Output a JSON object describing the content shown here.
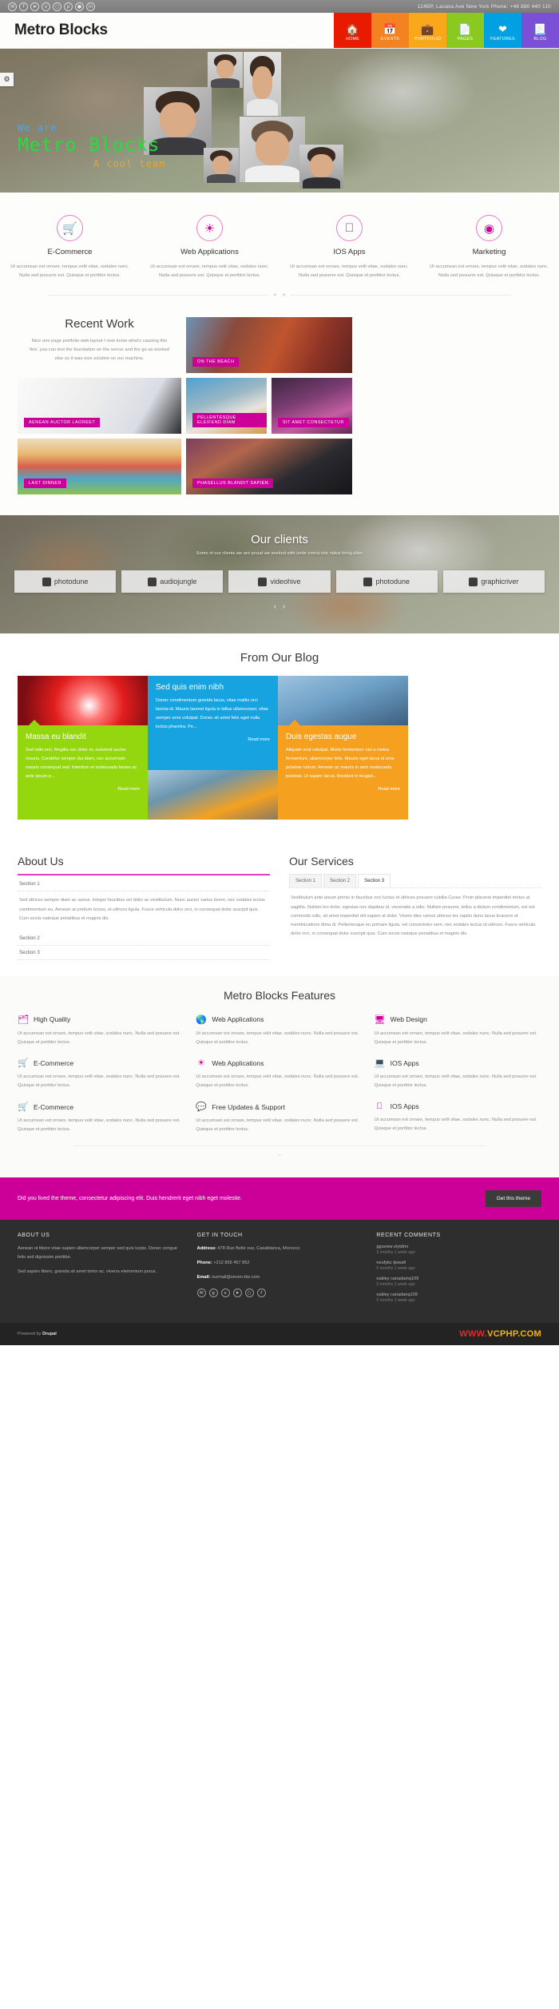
{
  "topbar": {
    "social": [
      "envelope",
      "facebook",
      "twitter",
      "vimeo",
      "github",
      "pinterest",
      "flickr",
      "linkedin"
    ],
    "contact": "124BP, Lacasa Ave New York Phone: +48 880 440 110"
  },
  "header": {
    "logo": "Metro Blocks",
    "nav": [
      {
        "label": "HOME",
        "icon": "⌂",
        "color": "#e81b00"
      },
      {
        "label": "EVENTS",
        "icon": "Ὄ5",
        "color": "#f58220"
      },
      {
        "label": "PORTFOLIO",
        "icon": "ὋC",
        "color": "#f9a71b"
      },
      {
        "label": "PAGES",
        "icon": "Ὄ4",
        "color": "#8bc920"
      },
      {
        "label": "FEATURES",
        "icon": "♥",
        "color": "#00a0e3"
      },
      {
        "label": "BLOG",
        "icon": "Ὄ3",
        "color": "#7b4fd6"
      }
    ]
  },
  "hero": {
    "gear_icon": "gear-icon",
    "we_are": "We are",
    "title": "Metro Blocks",
    "subtitle": "A cool team"
  },
  "services": {
    "items": [
      {
        "title": "E-Commerce",
        "icon": "Ὥ2",
        "desc": "Ut accumsan est ornare, tempus velit vitae, sodales nunc. Nulla sed posuere est. Quisque et porttitor lectus."
      },
      {
        "title": "Web Applications",
        "icon": "◔",
        "desc": "Ut accumsan est ornare, tempus velit vitae, sodales nunc. Nulla sed posuere est. Quisque et porttitor lectus."
      },
      {
        "title": "IOS Apps",
        "icon": "ἴE",
        "desc": "Ut accumsan est ornare, tempus velit vitae, sodales nunc. Nulla sed posuere est. Quisque et porttitor lectus."
      },
      {
        "title": "Marketing",
        "icon": "◎",
        "desc": "Ut accumsan est ornare, tempus velit vitae, sodales nunc. Nulla sed posuere est. Quisque et porttitor lectus."
      }
    ]
  },
  "recent_work": {
    "title": "Recent Work",
    "intro": "Nice one page portfolio web layout I now know what's causing this fine. you can test the foundation on the server and the go as worked else so it was nice solution on our machine.",
    "tiles": [
      {
        "caption": "ON THE BEACH"
      },
      {
        "caption": "AENEAN AUCTOR LAOREET"
      },
      {
        "caption": "PELLENTESQUE ELEIFEND DIAM"
      },
      {
        "caption": "SIT AMET CONSECTETUR"
      },
      {
        "caption": "LAST DINNER"
      },
      {
        "caption": "PHASELLUS BLANDIT SAPIEN"
      }
    ]
  },
  "clients": {
    "title": "Our clients",
    "subtitle": "Some of our clients we are proud we worked with unde omnis iste natus bring alien",
    "logos": [
      "photodune",
      "audiojungle",
      "videohive",
      "photodune",
      "graphicriver"
    ],
    "prev": "‹",
    "next": "›"
  },
  "blog": {
    "title": "From Our Blog",
    "posts": [
      {
        "title": "Sed quis enim nibh",
        "body": "Donec condimentum gravida lacus, vitae mattis orci lacinia id. Mauris laoreet ligula in tellus ullamcorper, vitae semper urna volutpat. Donec sit amet felis eget nulla luctus pharetra. Pe...",
        "readmore": "Read more"
      },
      {
        "title": "Massa eu blandit",
        "body": "Sed odio orci, fringilla nec dolor et, euismod auctor mauris. Curabitur semper dui diam, nec accumsan mauris consequat sed. Interdum et malesuada fames ac ante ipsum p...",
        "readmore": "Read more"
      },
      {
        "title": "Duis egestas augue",
        "body": "Aliquam erat volutpat. Morbi fermentum nisl a metus fermentum, ullamcorper felis. Mauris eget lacus id eros pulvinar rutrum. Aenean ac mauris in sem malesuada pulvinar. Ut sapien lacus, tincidunt in feugiat...",
        "readmore": "Read more"
      }
    ]
  },
  "about": {
    "title": "About Us",
    "sections": [
      {
        "label": "Section 1",
        "body": "Sed ultrices semper diam ac varius. Integer faucibus vel dolor ac vestibulum. Nunc auctor varius lorem, nec sodales lectus condimentum eu. Aenean at pretium lectus, et ultrices ligula. Fusce vehicula dolor orci, in consequat dolor suscipit quis. Cum sociis natoque penatibus et magnis dis."
      },
      {
        "label": "Section 2",
        "body": ""
      },
      {
        "label": "Section 3",
        "body": ""
      }
    ]
  },
  "our_services": {
    "title": "Our Services",
    "tabs": [
      "Section 1",
      "Section 2",
      "Section 3"
    ],
    "active_tab": "Section 3",
    "panel_body": "Vestibulum ante ipsum primis in faucibus orci luctus et ultrices posuere cubilia Curae; Proin placerat imperdiet metus at sagittis. Nullam leo dolor, egestas nec dapibus id, venenatis a odio. Nullam posuere, tellus a dictum condimentum, est est commodo odio, sit amet imperdiet elit sapien at dolor. Vivere dies ramos ultrices tes rapids duns lacus ticacens et mentinications dima di. Pellentesque eu primare ligula, vel consectetur sem. nec sodales lectus id ultrices. Fusce vehicula dolor orci, in consequat dolor suscipit quis. Cum sociis natoque penatibus et magnis dis."
  },
  "features": {
    "title": "Metro Blocks Features",
    "items": [
      {
        "title": "High Quality",
        "icon": "Ὗ2",
        "desc": "Ut accumsan est ornare, tempus velit vitae, sodales nunc. Nulla sed posuere est. Quisque et porttitor lectus."
      },
      {
        "title": "Web Applications",
        "icon": "ἰD",
        "desc": "Ut accumsan est ornare, tempus velit vitae, sodales nunc. Nulla sed posuere est. Quisque et porttitor lectus."
      },
      {
        "title": "Web Design",
        "icon": "὚5",
        "desc": "Ut accumsan est ornare, tempus velit vitae, sodales nunc. Nulla sed posuere est. Quisque et porttitor lectus."
      },
      {
        "title": "E-Commerce",
        "icon": "Ὥ2",
        "desc": "Ut accumsan est ornare, tempus velit vitae, sodales nunc. Nulla sed posuere est. Quisque et porttitor lectus."
      },
      {
        "title": "Web Applications",
        "icon": "◔",
        "desc": "Ut accumsan est ornare, tempus velit vitae, sodales nunc. Nulla sed posuere est. Quisque et porttitor lectus."
      },
      {
        "title": "IOS Apps",
        "icon": "ὋB",
        "desc": "Ut accumsan est ornare, tempus velit vitae, sodales nunc. Nulla sed posuere est. Quisque et porttitor lectus."
      },
      {
        "title": "E-Commerce",
        "icon": "Ὥ2",
        "desc": "Ut accumsan est ornare, tempus velit vitae, sodales nunc. Nulla sed posuere est. Quisque et porttitor lectus."
      },
      {
        "title": "Free Updates & Support",
        "icon": "ὊC",
        "desc": "Ut accumsan est ornare, tempus velit vitae, sodales nunc. Nulla sed posuere est. Quisque et porttitor lectus."
      },
      {
        "title": "IOS Apps",
        "icon": "ἴE",
        "desc": "Ut accumsan est ornare, tempus velit vitae, sodales nunc. Nulla sed posuere est. Quisque et porttitor lectus."
      }
    ],
    "scroll_arrow": "⌄"
  },
  "cta": {
    "text": "Did you lived the theme, consectetur adipiscing elit. Duis hendrerit eget nibh eget molestie.",
    "button": "Get this theme"
  },
  "footer": {
    "about": {
      "heading": "ABOUT US",
      "p1": "Aenean ut libero vitae sapien ullamcorper semper sed quis turpis. Donec congue felis sed dignissim porttitor.",
      "p2": "Sed sapien libero, gravida sit amet tortor ac, viverra elementum purus."
    },
    "touch": {
      "heading": "GET IN TOUCH",
      "address_label": "Address:",
      "address": "478 Rue Belle vue, Casablanca, Morocco",
      "phone_label": "Phone:",
      "phone": "+212 856 457 852",
      "email_label": "Email:",
      "email": "ourmail@seven-biz.com",
      "social": [
        "envelope",
        "google-plus",
        "vimeo",
        "twitter",
        "github",
        "facebook"
      ]
    },
    "comments": {
      "heading": "RECENT COMMENTS",
      "items": [
        {
          "name": "gguvww elytdmr",
          "meta": "3 months 1 week ago"
        },
        {
          "name": "neufybc tjswafi",
          "meta": "5 months 1 week ago"
        },
        {
          "name": "oakley canadainq109",
          "meta": "5 months 1 week ago"
        },
        {
          "name": "oakley canadanq109",
          "meta": "5 months 1 week ago"
        }
      ]
    },
    "powered_prefix": "Powered by ",
    "powered_name": "Drupal",
    "watermark_www": "WWW.",
    "watermark_name": "VCPHP.COM"
  }
}
